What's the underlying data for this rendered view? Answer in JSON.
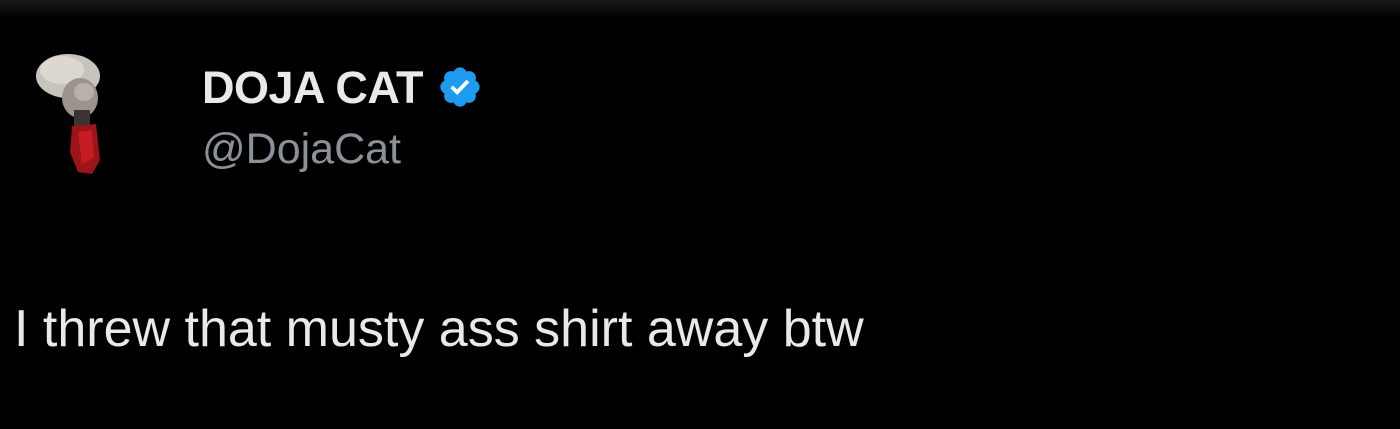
{
  "tweet": {
    "author": {
      "display_name": "DOJA CAT",
      "handle": "@DojaCat",
      "verified": true,
      "verified_color": "#1d9bf0",
      "avatar_icon": "profile-photo"
    },
    "text": "I threw that musty ass shirt away btw"
  },
  "theme": {
    "background": "#000000",
    "primary_text": "#e7e9ea",
    "secondary_text": "#8b9198"
  }
}
